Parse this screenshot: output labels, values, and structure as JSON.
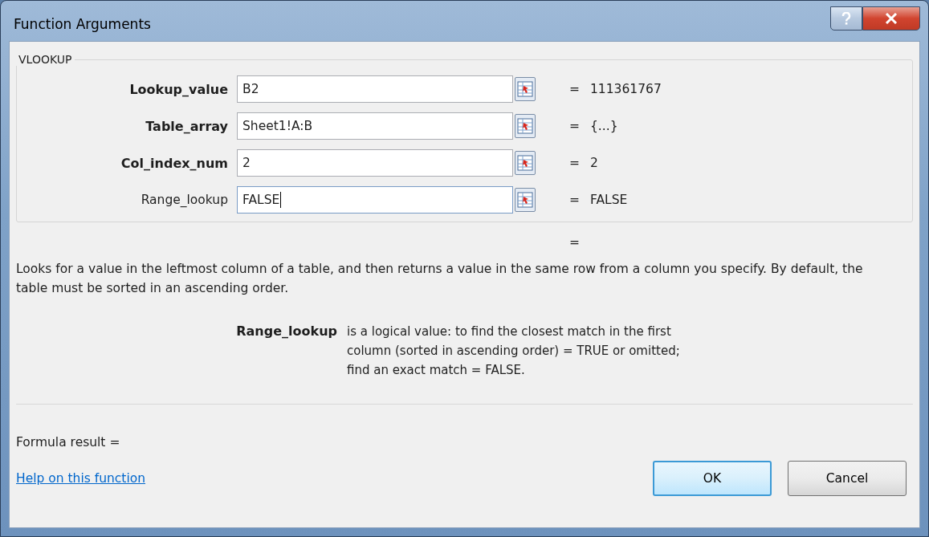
{
  "window": {
    "title": "Function Arguments"
  },
  "function": {
    "name": "VLOOKUP",
    "arguments": [
      {
        "label": "Lookup_value",
        "required": true,
        "value": "B2",
        "sign": "=",
        "result": "111361767",
        "focused": false
      },
      {
        "label": "Table_array",
        "required": true,
        "value": "Sheet1!A:B",
        "sign": "=",
        "result": "{...}",
        "focused": false
      },
      {
        "label": "Col_index_num",
        "required": true,
        "value": "2",
        "sign": "=",
        "result": "2",
        "focused": false
      },
      {
        "label": "Range_lookup",
        "required": false,
        "value": "FALSE",
        "sign": "=",
        "result": "FALSE",
        "focused": true
      }
    ],
    "result_sign": "=",
    "description": "Looks for a value in the leftmost column of a table, and then returns a value in the same row from a column you specify. By default, the table must be sorted in an ascending order.",
    "argument_help": {
      "name": "Range_lookup",
      "text": "is a logical value: to find the closest match in the first column (sorted in ascending order) = TRUE or omitted; find an exact match = FALSE."
    }
  },
  "formula_result": "Formula result =",
  "help_link": "Help on this function",
  "buttons": [
    {
      "label": "OK",
      "default": true
    },
    {
      "label": "Cancel",
      "default": false
    }
  ]
}
